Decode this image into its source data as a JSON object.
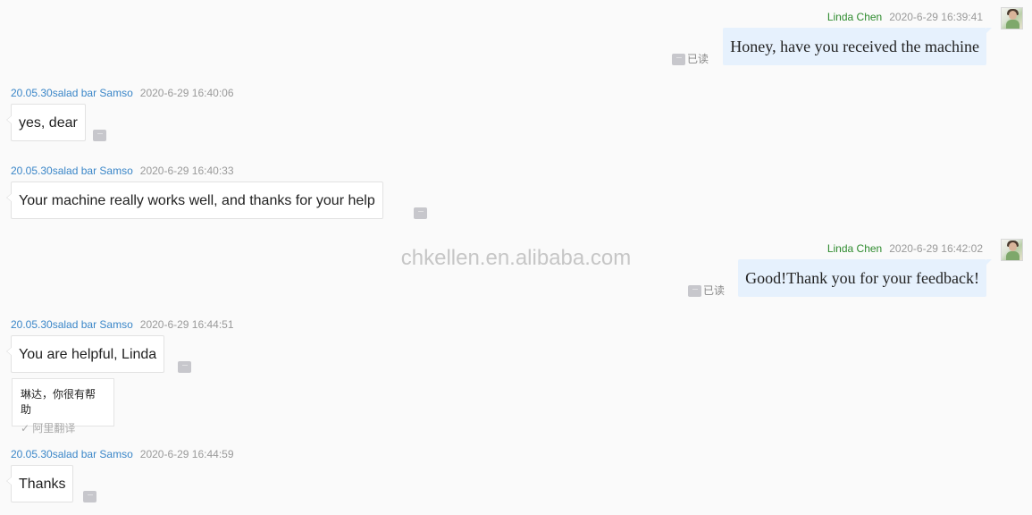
{
  "watermark": "chkellen.en.alibaba.com",
  "status": {
    "read": "已读",
    "more": "···"
  },
  "messages": [
    {
      "sender": "Linda Chen",
      "time": "2020-6-29 16:39:41",
      "text": "Honey, have you received the machine",
      "direction": "out"
    },
    {
      "sender": "20.05.30salad bar Samso",
      "time": "2020-6-29 16:40:06",
      "text": "yes, dear",
      "direction": "in"
    },
    {
      "sender": "20.05.30salad bar Samso",
      "time": "2020-6-29 16:40:33",
      "text": "Your machine really works well, and thanks for your help",
      "direction": "in"
    },
    {
      "sender": "Linda Chen",
      "time": "2020-6-29 16:42:02",
      "text": "Good!Thank you for your feedback!",
      "direction": "out"
    },
    {
      "sender": "20.05.30salad bar Samso",
      "time": "2020-6-29 16:44:51",
      "text": "You are helpful, Linda",
      "direction": "in",
      "translation": {
        "text": "琳达，你很有帮助",
        "source": "阿里翻译"
      }
    },
    {
      "sender": "20.05.30salad bar Samso",
      "time": "2020-6-29 16:44:59",
      "text": "Thanks",
      "direction": "in"
    }
  ],
  "colors": {
    "outgoing_name": "#2e8b2e",
    "incoming_name": "#3a86c8",
    "outgoing_bubble": "#e6f1fd",
    "incoming_bubble": "#ffffff"
  }
}
